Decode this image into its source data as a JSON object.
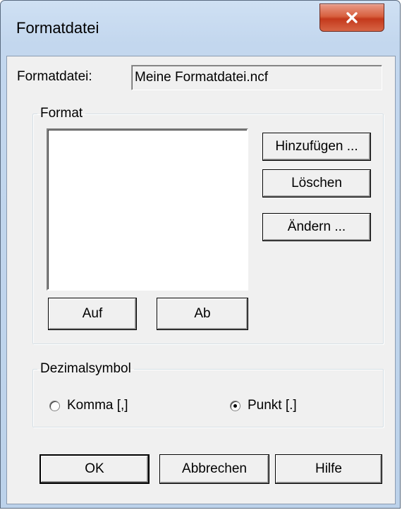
{
  "window": {
    "title": "Formatdatei"
  },
  "file": {
    "label": "Formatdatei:",
    "value": "Meine Formatdatei.ncf"
  },
  "format_group": {
    "legend": "Format",
    "add_button": "Hinzufügen ...",
    "delete_button": "Löschen",
    "change_button": "Ändern ...",
    "up_button": "Auf",
    "down_button": "Ab"
  },
  "decimal_group": {
    "legend": "Dezimalsymbol",
    "options": [
      {
        "label": "Komma [,]",
        "checked": false
      },
      {
        "label": "Punkt [.]",
        "checked": true
      }
    ]
  },
  "footer": {
    "ok": "OK",
    "cancel": "Abbrechen",
    "help": "Hilfe"
  },
  "colors": {
    "close_button": "#c4391c",
    "frame": "#c3d7ee",
    "client": "#f0f0f0"
  }
}
